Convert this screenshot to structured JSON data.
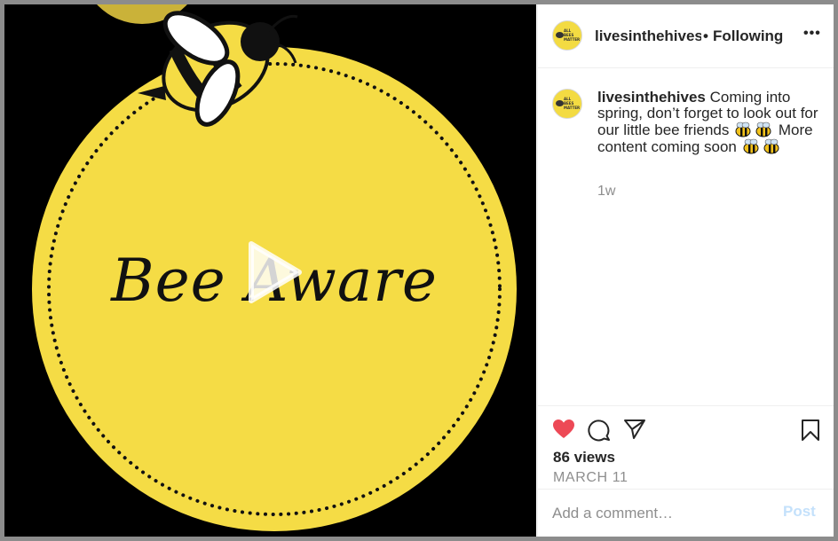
{
  "post": {
    "username": "livesinthehives",
    "separator": "•",
    "follow_label": "Following",
    "more_label": "•••",
    "avatar_text": "ALL BEES MATTER",
    "caption_text": "Coming into spring, don’t forget to look out for our little bee friends",
    "caption_text_2": "More content coming soon",
    "time_ago": "1w",
    "views_label": "86 views",
    "date_label": "MARCH 11",
    "comment_placeholder": "Add a comment…",
    "post_label": "Post",
    "liked": true
  },
  "media": {
    "title_text": "Bee Aware",
    "background": "#000000",
    "circle_color": "#f5dc45",
    "text_color": "#111111"
  },
  "colors": {
    "heart": "#ed4956",
    "post_button_disabled": "#c4e1fb",
    "muted": "#8e8e8e",
    "frame_border": "#8c8c8c"
  }
}
